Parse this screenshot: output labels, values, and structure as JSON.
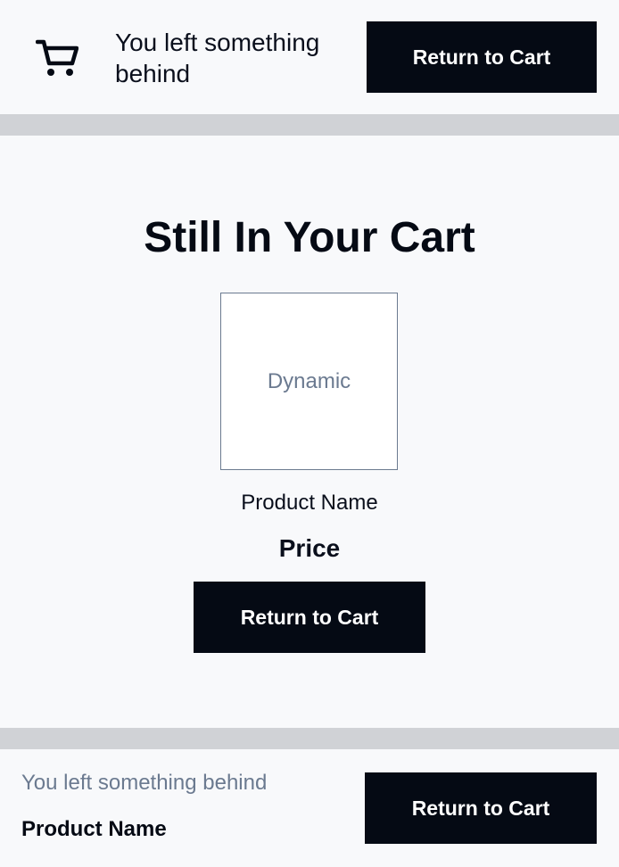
{
  "header": {
    "icon": "shopping-cart-icon",
    "message": "You left something behind",
    "button_label": "Return to Cart"
  },
  "main": {
    "title": "Still In Your Cart",
    "image_placeholder": "Dynamic",
    "product_name": "Product Name",
    "price": "Price",
    "button_label": "Return to Cart"
  },
  "footer": {
    "message": "You left something behind",
    "product_name": "Product Name",
    "button_label": "Return to Cart"
  },
  "colors": {
    "background": "#f8f9fb",
    "divider": "#d0d2d6",
    "button": "#050a14",
    "muted_text": "#6b7a90"
  }
}
